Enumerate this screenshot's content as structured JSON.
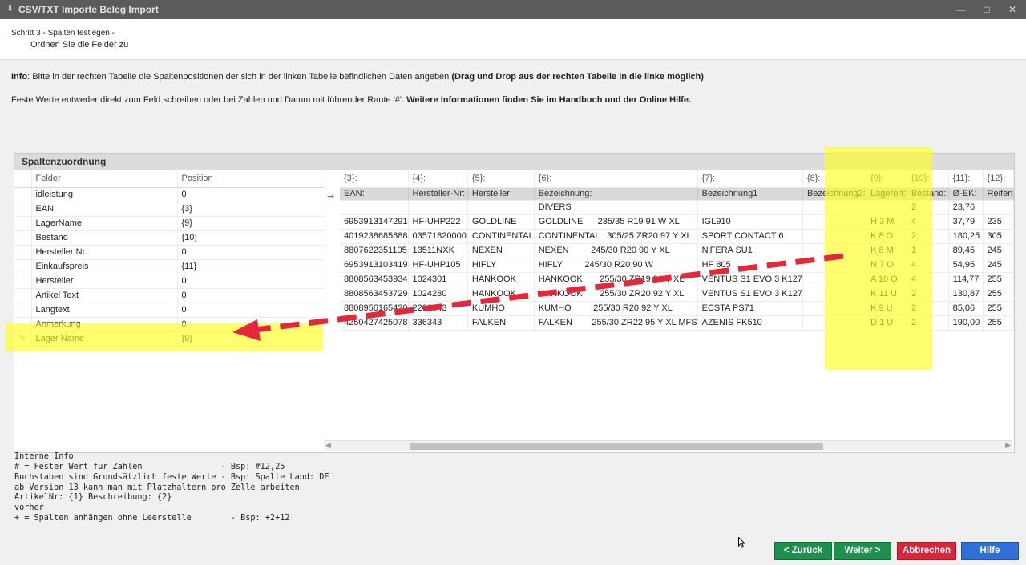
{
  "window": {
    "title": "CSV/TXT Importe Beleg Import",
    "app_icon": "download-icon",
    "minimize": "minimize-icon",
    "maximize": "maximize-icon",
    "close": "close-icon"
  },
  "header": {
    "step": "Schritt 3 - Spalten festlegen -",
    "substep": "Ordnen Sie die Felder zu"
  },
  "info": {
    "line1_label": "Info",
    "line1_text": ": Bitte in der rechten Tabelle die Spaltenpositionen der sich in der linken Tabelle befindlichen Daten angeben ",
    "line1_bold": "(Drag und Drop aus der rechten Tabelle in die linke möglich)",
    "line1_end": ".",
    "line2_text": "Feste Werte entweder direkt zum Feld schreiben oder bei  Zahlen und Datum mit führender Raute '#'. ",
    "line2_bold": "Weitere Informationen finden Sie im Handbuch und der Online Hilfe."
  },
  "panel": {
    "title": "Spaltenzuordnung"
  },
  "left_table": {
    "headers": [
      "Felder",
      "Position"
    ],
    "rows": [
      {
        "field": "idleistung",
        "position": "0"
      },
      {
        "field": "EAN",
        "position": "{3}"
      },
      {
        "field": "LagerName",
        "position": "{9}"
      },
      {
        "field": "Bestand",
        "position": "{10}"
      },
      {
        "field": "Hersteller Nr.",
        "position": "0"
      },
      {
        "field": "Einkaufspreis",
        "position": "{11}"
      },
      {
        "field": "Hersteller",
        "position": "0"
      },
      {
        "field": "Artikel Text",
        "position": "0"
      },
      {
        "field": "Langtext",
        "position": "0"
      },
      {
        "field": "Anmerkung",
        "position": "0"
      },
      {
        "field": "Lager Name",
        "position": "{9}"
      }
    ]
  },
  "right_table": {
    "col_numbers": [
      "{3}:",
      "{4}:",
      "{5}:",
      "{6}:",
      "{7}:",
      "{8}:",
      "{9}:",
      "{10}:",
      "{11}:",
      "{12}:"
    ],
    "col_names": [
      "EAN:",
      "Hersteller-Nr:",
      "Hersteller:",
      "Bezeichnung:",
      "Bezeichnung1",
      "Bezeichnung2:",
      "Lagerort:",
      "Bestand:",
      "Ø-EK:",
      "Reifen"
    ],
    "rows": [
      [
        "",
        "",
        "",
        "DIVERS",
        "",
        "",
        "",
        "2",
        "23,76",
        ""
      ],
      [
        "6953913147291",
        "HF-UHP222",
        "GOLDLINE",
        "GOLDLINE      235/35 R19 91 W XL",
        "IGL910",
        "",
        "H 3 M",
        "4",
        "37,79",
        "235"
      ],
      [
        "4019238685688",
        "03571820000",
        "CONTINENTAL",
        "CONTINENTAL   305/25 ZR20 97 Y XL",
        "SPORT CONTACT 6",
        "",
        "K 8 O",
        "2",
        "180,25",
        "305"
      ],
      [
        "8807622351105",
        "13511NXK",
        "NEXEN",
        "NEXEN         245/30 R20 90 Y XL",
        "N'FERA SU1",
        "",
        "K 8 M",
        "1",
        "89,45",
        "245"
      ],
      [
        "6953913103419",
        "HF-UHP105",
        "HIFLY",
        "HIFLY         245/30 R20 90 W",
        "HF 805",
        "",
        "N 7 O",
        "4",
        "54,95",
        "245"
      ],
      [
        "8808563453934",
        "1024301",
        "HANKOOK",
        "HANKOOK       255/30 ZR19 91 Y XL",
        "VENTUS S1 EVO 3 K127",
        "",
        "A 10 O",
        "4",
        "114,77",
        "255"
      ],
      [
        "8808563453729",
        "1024280",
        "HANKOOK",
        "HANKOOK       255/30 ZR20 92 Y XL",
        "VENTUS S1 EVO 3 K127",
        "",
        "K 11 U",
        "2",
        "130,87",
        "255"
      ],
      [
        "8808956165420",
        "2206643",
        "KUMHO",
        "KUMHO         255/30 R20 92 Y XL",
        "ECSTA PS71",
        "",
        "K 9 U",
        "2",
        "85,06",
        "255"
      ],
      [
        "4250427425078",
        "336343",
        "FALKEN",
        "FALKEN        255/30 ZR22 95 Y XL MFS",
        "AZENIS FK510",
        "",
        "D 1 U",
        "2",
        "190,00",
        "255"
      ]
    ]
  },
  "internal_info": [
    "Interne Info",
    "# = Fester Wert für Zahlen                - Bsp: #12,25",
    "Buchstaben sind Grundsätzlich feste Werte - Bsp: Spalte Land: DE",
    "ab Version 13 kann man mit Platzhaltern pro Zelle arbeiten",
    "ArtikelNr: {1} Beschreibung: {2}",
    "vorher",
    "+ = Spalten anhängen ohne Leerstelle        - Bsp: +2+12"
  ],
  "buttons": {
    "back": "< Zurück",
    "next": "Weiter >",
    "cancel": "Abbrechen",
    "help": "Hilfe"
  },
  "colors": {
    "back": "#1f8f4e",
    "next": "#1f8f4e",
    "cancel": "#d9263a",
    "help": "#2f6fd6",
    "highlight": "#ffff19",
    "arrow": "#e2283a"
  }
}
